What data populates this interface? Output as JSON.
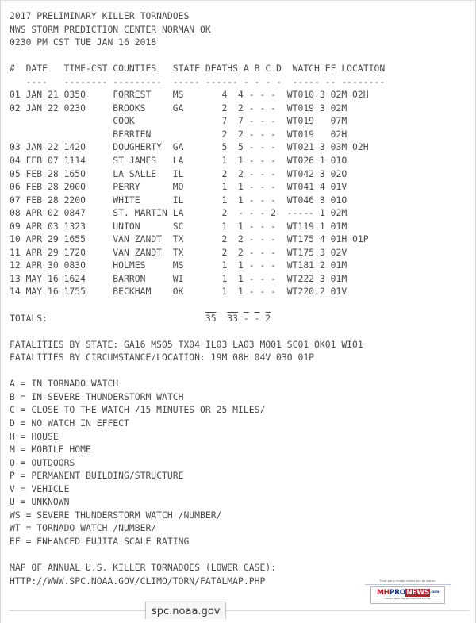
{
  "document": {
    "title_lines": [
      "2017 PRELIMINARY KILLER TORNADOES",
      "NWS STORM PREDICTION CENTER NORMAN OK",
      "0230 PM CST TUE JAN 16 2018"
    ],
    "table": {
      "header": "#  DATE   TIME-CST COUNTIES   STATE DEATHS A B C D  WATCH EF LOCATION",
      "rule": "   ----   -------- ---------  ----- ------ - - - -  ----- -- --------",
      "columns": [
        "#",
        "DATE",
        "TIME-CST",
        "COUNTIES",
        "STATE",
        "DEATHS",
        "A",
        "B",
        "C",
        "D",
        "WATCH",
        "EF",
        "LOCATION"
      ],
      "rows": [
        {
          "num": "01",
          "date": "JAN 21",
          "time": "0350",
          "county": "FORREST",
          "state": "MS",
          "deaths": "4",
          "a": "4",
          "b": "-",
          "c": "-",
          "d": "-",
          "watch": "WT010",
          "ef": "3",
          "location": "02M 02H"
        },
        {
          "num": "02",
          "date": "JAN 22",
          "time": "0230",
          "county": "BROOKS",
          "state": "GA",
          "deaths": "2",
          "a": "2",
          "b": "-",
          "c": "-",
          "d": "-",
          "watch": "WT019",
          "ef": "3",
          "location": "02M"
        },
        {
          "num": "",
          "date": "",
          "time": "",
          "county": "COOK",
          "state": "",
          "deaths": "7",
          "a": "7",
          "b": "-",
          "c": "-",
          "d": "-",
          "watch": "WT019",
          "ef": "",
          "location": "07M"
        },
        {
          "num": "",
          "date": "",
          "time": "",
          "county": "BERRIEN",
          "state": "",
          "deaths": "2",
          "a": "2",
          "b": "-",
          "c": "-",
          "d": "-",
          "watch": "WT019",
          "ef": "",
          "location": "02H"
        },
        {
          "num": "03",
          "date": "JAN 22",
          "time": "1420",
          "county": "DOUGHERTY",
          "state": "GA",
          "deaths": "5",
          "a": "5",
          "b": "-",
          "c": "-",
          "d": "-",
          "watch": "WT021",
          "ef": "3",
          "location": "03M 02H"
        },
        {
          "num": "04",
          "date": "FEB 07",
          "time": "1114",
          "county": "ST JAMES",
          "state": "LA",
          "deaths": "1",
          "a": "1",
          "b": "-",
          "c": "-",
          "d": "-",
          "watch": "WT026",
          "ef": "1",
          "location": "01O"
        },
        {
          "num": "05",
          "date": "FEB 28",
          "time": "1650",
          "county": "LA SALLE",
          "state": "IL",
          "deaths": "2",
          "a": "2",
          "b": "-",
          "c": "-",
          "d": "-",
          "watch": "WT042",
          "ef": "3",
          "location": "02O"
        },
        {
          "num": "06",
          "date": "FEB 28",
          "time": "2000",
          "county": "PERRY",
          "state": "MO",
          "deaths": "1",
          "a": "1",
          "b": "-",
          "c": "-",
          "d": "-",
          "watch": "WT041",
          "ef": "4",
          "location": "01V"
        },
        {
          "num": "07",
          "date": "FEB 28",
          "time": "2200",
          "county": "WHITE",
          "state": "IL",
          "deaths": "1",
          "a": "1",
          "b": "-",
          "c": "-",
          "d": "-",
          "watch": "WT046",
          "ef": "3",
          "location": "01O"
        },
        {
          "num": "08",
          "date": "APR 02",
          "time": "0847",
          "county": "ST. MARTIN",
          "state": "LA",
          "deaths": "2",
          "a": "-",
          "b": "-",
          "c": "-",
          "d": "2",
          "watch": "-----",
          "ef": "1",
          "location": "02M"
        },
        {
          "num": "09",
          "date": "APR 03",
          "time": "1323",
          "county": "UNION",
          "state": "SC",
          "deaths": "1",
          "a": "1",
          "b": "-",
          "c": "-",
          "d": "-",
          "watch": "WT119",
          "ef": "1",
          "location": "01M"
        },
        {
          "num": "10",
          "date": "APR 29",
          "time": "1655",
          "county": "VAN ZANDT",
          "state": "TX",
          "deaths": "2",
          "a": "2",
          "b": "-",
          "c": "-",
          "d": "-",
          "watch": "WT175",
          "ef": "4",
          "location": "01H 01P"
        },
        {
          "num": "11",
          "date": "APR 29",
          "time": "1720",
          "county": "VAN ZANDT",
          "state": "TX",
          "deaths": "2",
          "a": "2",
          "b": "-",
          "c": "-",
          "d": "-",
          "watch": "WT175",
          "ef": "3",
          "location": "02V"
        },
        {
          "num": "12",
          "date": "APR 30",
          "time": "0830",
          "county": "HOLMES",
          "state": "MS",
          "deaths": "1",
          "a": "1",
          "b": "-",
          "c": "-",
          "d": "-",
          "watch": "WT181",
          "ef": "2",
          "location": "01M"
        },
        {
          "num": "13",
          "date": "MAY 16",
          "time": "1624",
          "county": "BARRON",
          "state": "WI",
          "deaths": "1",
          "a": "1",
          "b": "-",
          "c": "-",
          "d": "-",
          "watch": "WT222",
          "ef": "3",
          "location": "01M"
        },
        {
          "num": "14",
          "date": "MAY 16",
          "time": "1755",
          "county": "BECKHAM",
          "state": "OK",
          "deaths": "1",
          "a": "1",
          "b": "-",
          "c": "-",
          "d": "-",
          "watch": "WT220",
          "ef": "2",
          "location": "01V"
        }
      ],
      "totals": {
        "label": "TOTALS:",
        "deaths": "35",
        "a": "33",
        "b": "-",
        "c": "-",
        "d": "2"
      }
    },
    "summary_lines": [
      "FATALITIES BY STATE: GA16 MS05 TX04 IL03 LA03 MO01 SC01 OK01 WI01",
      "FATALITIES BY CIRCUMSTANCE/LOCATION: 19M 08H 04V 03O 01P"
    ],
    "legend": [
      "A = IN TORNADO WATCH",
      "B = IN SEVERE THUNDERSTORM WATCH",
      "C = CLOSE TO THE WATCH /15 MINUTES OR 25 MILES/",
      "D = NO WATCH IN EFFECT",
      "H = HOUSE",
      "M = MOBILE HOME",
      "O = OUTDOORS",
      "P = PERMANENT BUILDING/STRUCTURE",
      "V = VEHICLE",
      "U = UNKNOWN",
      "WS = SEVERE THUNDERSTORM WATCH /NUMBER/",
      "WT = TORNADO WATCH /NUMBER/",
      "EF = ENHANCED FUJITA SCALE RATING"
    ],
    "footer_lines": [
      "MAP OF ANNUAL U.S. KILLER TORNADOES (LOWER CASE):",
      "HTTP://WWW.SPC.NOAA.GOV/CLIMO/TORN/FATALMAP.PHP"
    ]
  },
  "browser": {
    "link_status": "spc.noaa.gov"
  },
  "credit": {
    "notice": "Third party image credits are as shown.",
    "logo": {
      "mh": "MH",
      "pro": "PRO",
      "news": "NEWS",
      "dotcom": ".com",
      "tagline": "Industry News, Tips and Views Pros Can Use"
    }
  },
  "colors": {
    "text": "#4c4c4c",
    "logo_red": "#c0202a",
    "logo_blue": "#18348c",
    "page_bg": "#ffffff"
  }
}
